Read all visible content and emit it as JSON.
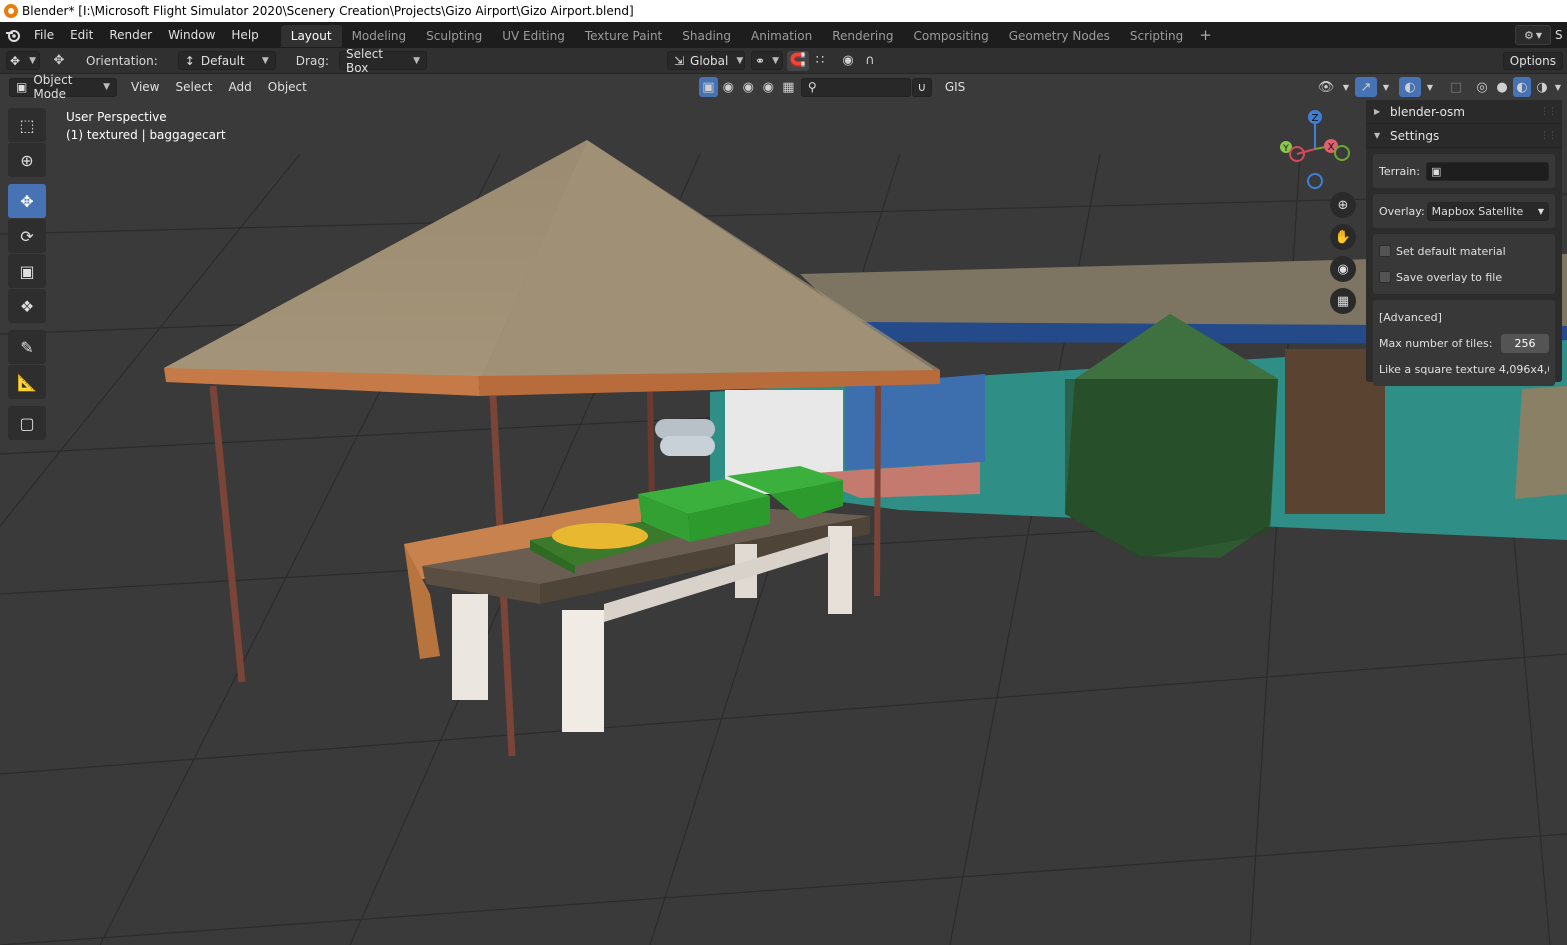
{
  "window": {
    "title": "Blender* [I:\\Microsoft Flight Simulator 2020\\Scenery Creation\\Projects\\Gizo Airport\\Gizo Airport.blend]"
  },
  "menu": {
    "items": [
      "File",
      "Edit",
      "Render",
      "Window",
      "Help"
    ]
  },
  "workspaces": {
    "tabs": [
      "Layout",
      "Modeling",
      "Sculpting",
      "UV Editing",
      "Texture Paint",
      "Shading",
      "Animation",
      "Rendering",
      "Compositing",
      "Geometry Nodes",
      "Scripting"
    ],
    "active": "Layout",
    "add": "+"
  },
  "topright": {
    "scene_label": "S"
  },
  "tool_header": {
    "orientation_label": "Orientation:",
    "orientation_value": "Default",
    "drag_label": "Drag:",
    "drag_value": "Select Box",
    "transform_orientation": "Global",
    "options_label": "Options"
  },
  "viewport_header": {
    "mode": "Object Mode",
    "menus": [
      "View",
      "Select",
      "Add",
      "Object"
    ],
    "gis_label": "GIS"
  },
  "viewport": {
    "perspective": "User Perspective",
    "object_info": "(1) textured | baggagecart"
  },
  "gizmo": {
    "z": "Z",
    "y": "Y",
    "x": "X"
  },
  "npanel": {
    "header_osm": "blender-osm",
    "header_settings": "Settings",
    "terrain_label": "Terrain:",
    "overlay_label": "Overlay:",
    "overlay_value": "Mapbox Satellite",
    "set_default_material": "Set default material",
    "save_overlay": "Save overlay to file",
    "advanced": "[Advanced]",
    "max_tiles_label": "Max number of tiles:",
    "max_tiles_value": "256",
    "square_texture_note": "Like a square texture 4,096x4,0..."
  },
  "colors": {
    "accent": "#4772b3",
    "background": "#303030",
    "grid": "#3a3a3a"
  }
}
